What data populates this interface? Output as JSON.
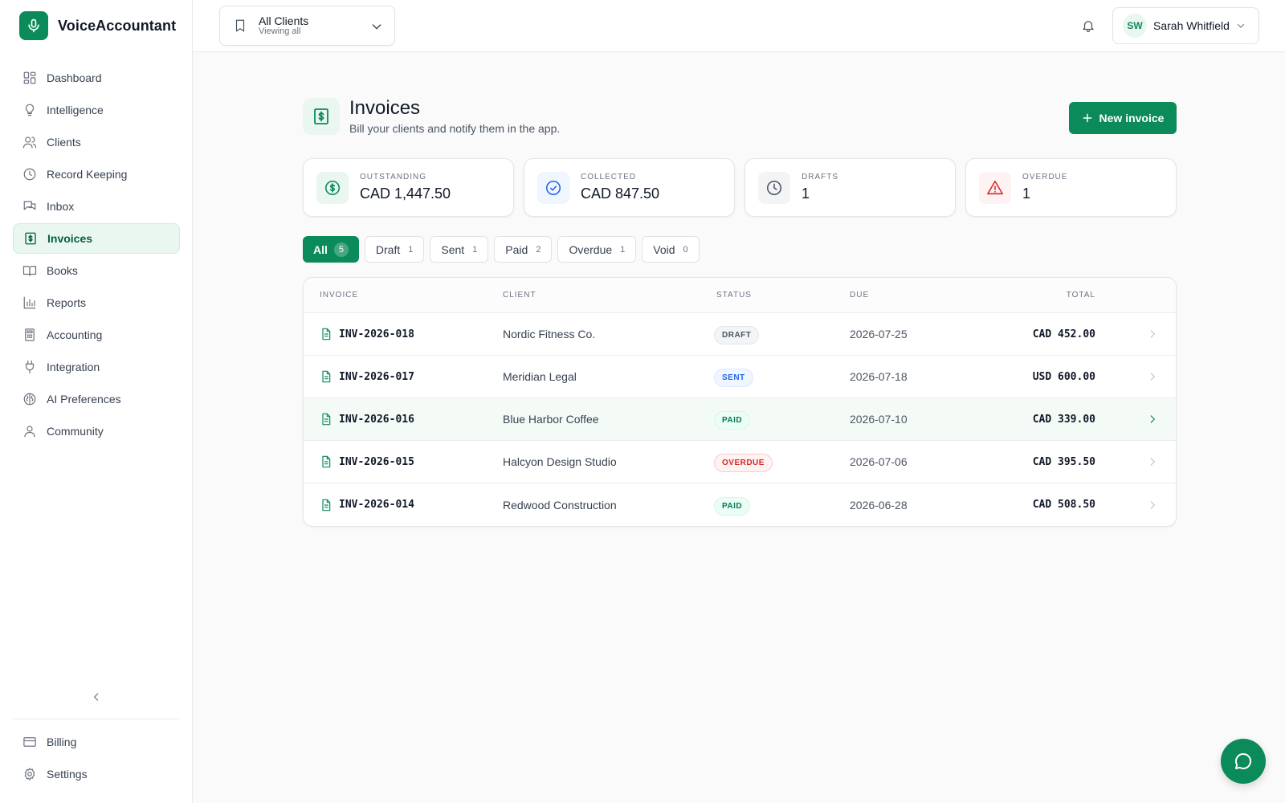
{
  "app": {
    "name": "VoiceAccountant",
    "logo_icon": "microphone-icon",
    "accent": "#0b8a5a"
  },
  "sidebar": {
    "items": [
      {
        "label": "Dashboard",
        "icon": "dashboard-grid-icon"
      },
      {
        "label": "Intelligence",
        "icon": "lightbulb-icon"
      },
      {
        "label": "Clients",
        "icon": "users-icon"
      },
      {
        "label": "Record Keeping",
        "icon": "clock-icon"
      },
      {
        "label": "Inbox",
        "icon": "chat-bubbles-icon"
      },
      {
        "label": "Invoices",
        "icon": "invoice-dollar-icon",
        "active": true
      },
      {
        "label": "Books",
        "icon": "open-book-icon"
      },
      {
        "label": "Reports",
        "icon": "bar-chart-icon"
      },
      {
        "label": "Accounting",
        "icon": "calculator-icon"
      },
      {
        "label": "Integration",
        "icon": "plug-icon"
      },
      {
        "label": "AI Preferences",
        "icon": "brain-icon"
      },
      {
        "label": "Community",
        "icon": "person-icon"
      }
    ],
    "bottom_items": [
      {
        "label": "Billing",
        "icon": "credit-card-icon"
      },
      {
        "label": "Settings",
        "icon": "gear-icon"
      }
    ]
  },
  "topbar": {
    "client_selector": {
      "title": "All Clients",
      "subtitle": "Viewing all"
    },
    "user": {
      "initials": "SW",
      "name": "Sarah Whitfield"
    }
  },
  "page": {
    "title": "Invoices",
    "subtitle": "Bill your clients and notify them in the app.",
    "new_button": "New invoice"
  },
  "stats": [
    {
      "label": "OUTSTANDING",
      "value": "CAD 1,447.50",
      "icon": "dollar-circle-icon",
      "color": "#0b8a5a"
    },
    {
      "label": "COLLECTED",
      "value": "CAD 847.50",
      "icon": "check-circle-icon",
      "color": "#2563eb"
    },
    {
      "label": "DRAFTS",
      "value": "1",
      "icon": "clock-icon",
      "color": "#4b5563"
    },
    {
      "label": "OVERDUE",
      "value": "1",
      "icon": "warning-triangle-icon",
      "color": "#dc2626"
    }
  ],
  "filters": [
    {
      "label": "All",
      "count": "5",
      "active": true
    },
    {
      "label": "Draft",
      "count": "1"
    },
    {
      "label": "Sent",
      "count": "1"
    },
    {
      "label": "Paid",
      "count": "2"
    },
    {
      "label": "Overdue",
      "count": "1"
    },
    {
      "label": "Void",
      "count": "0"
    }
  ],
  "table": {
    "headers": {
      "invoice": "INVOICE",
      "client": "CLIENT",
      "status": "STATUS",
      "due": "DUE",
      "total": "TOTAL"
    },
    "rows": [
      {
        "invoice": "INV-2026-018",
        "client": "Nordic Fitness Co.",
        "status": "DRAFT",
        "due": "2026-07-25",
        "total": "CAD 452.00"
      },
      {
        "invoice": "INV-2026-017",
        "client": "Meridian Legal",
        "status": "SENT",
        "due": "2026-07-18",
        "total": "USD 600.00"
      },
      {
        "invoice": "INV-2026-016",
        "client": "Blue Harbor Coffee",
        "status": "PAID",
        "due": "2026-07-10",
        "total": "CAD 339.00",
        "highlighted": true
      },
      {
        "invoice": "INV-2026-015",
        "client": "Halcyon Design Studio",
        "status": "OVERDUE",
        "due": "2026-07-06",
        "total": "CAD 395.50"
      },
      {
        "invoice": "INV-2026-014",
        "client": "Redwood Construction",
        "status": "PAID",
        "due": "2026-06-28",
        "total": "CAD 508.50"
      }
    ]
  }
}
